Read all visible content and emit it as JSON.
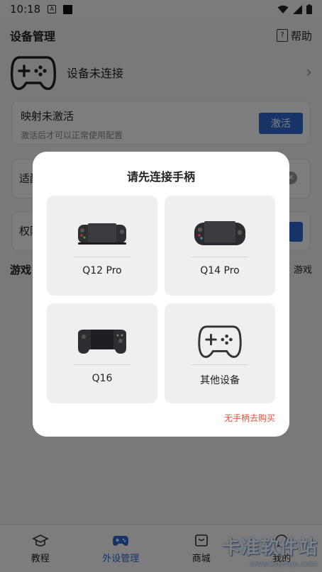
{
  "statusbar": {
    "time": "10:18",
    "a_icon": "A"
  },
  "header": {
    "title": "设备管理",
    "help": "帮助"
  },
  "device": {
    "status": "设备未连接"
  },
  "activate_card": {
    "title": "映射未激活",
    "subtitle": "激活后才可以正常使用配置",
    "button": "激活"
  },
  "adapt_card": {
    "title_partial": "适配"
  },
  "perm_card": {
    "title_partial": "权限"
  },
  "game_row": {
    "left": "游戏",
    "right": "游戏"
  },
  "dialog": {
    "title": "请先连接手柄",
    "devices": [
      {
        "label": "Q12 Pro"
      },
      {
        "label": "Q14 Pro"
      },
      {
        "label": "Q16"
      },
      {
        "label": "其他设备"
      }
    ],
    "buy_link": "无手柄去购买"
  },
  "nav": [
    {
      "label": "教程"
    },
    {
      "label": "外设管理"
    },
    {
      "label": "商城"
    },
    {
      "label": "我的"
    }
  ],
  "watermark": {
    "line1": "卡准软件站",
    "line2": "www.kazhun.com"
  },
  "colors": {
    "accent": "#2c69d1",
    "link": "#e0523c"
  },
  "icons": [
    "gamepad-icon",
    "help-icon",
    "chevron-right-icon",
    "close-circle-icon",
    "graduation-cap-icon",
    "gamepad-nav-icon",
    "shop-bag-icon",
    "wifi-icon",
    "signal-icon",
    "battery-icon"
  ]
}
